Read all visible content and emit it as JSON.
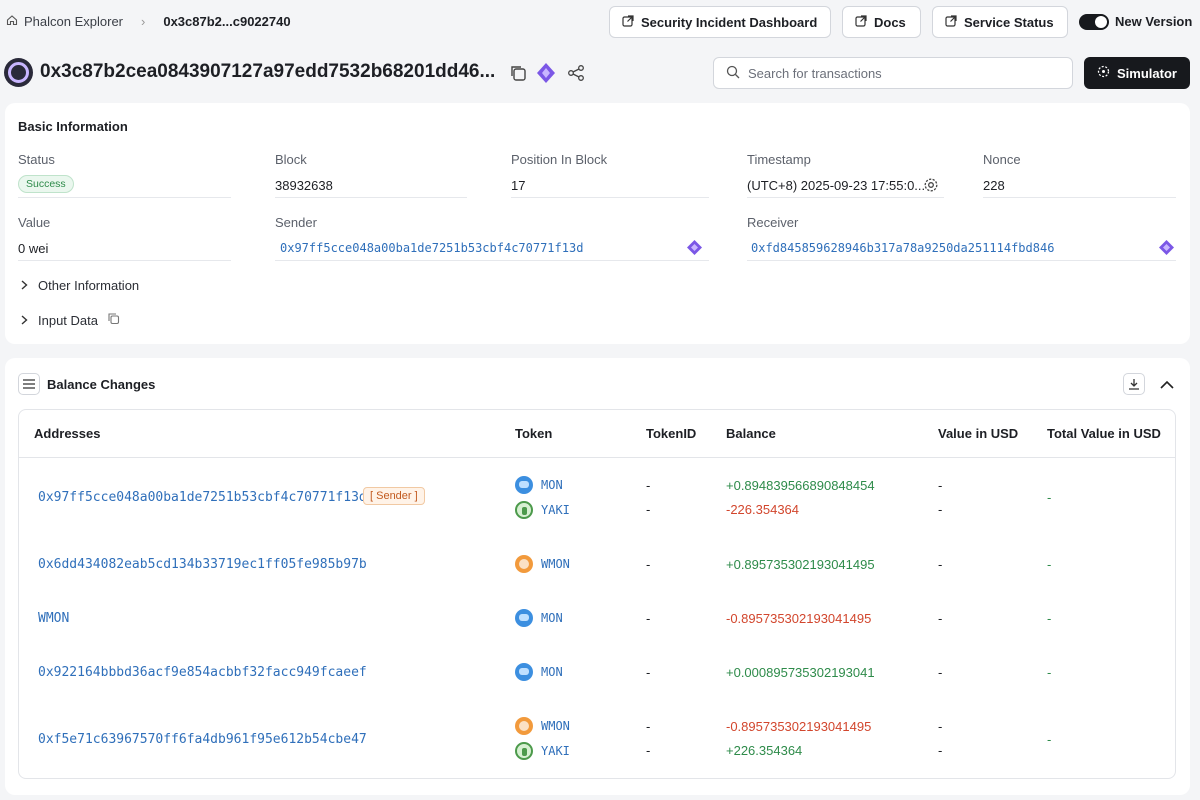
{
  "breadcrumb": {
    "home": "Phalcon Explorer",
    "current": "0x3c87b2...c9022740"
  },
  "header_buttons": {
    "incident": "Security Incident Dashboard",
    "docs": "Docs",
    "status": "Service Status",
    "new_version": "New Version"
  },
  "tx": {
    "hash": "0x3c87b2cea0843907127a97edd7532b68201dd46..."
  },
  "search": {
    "placeholder": "Search for transactions"
  },
  "simulator": {
    "label": "Simulator"
  },
  "basic": {
    "title": "Basic Information",
    "status_label": "Status",
    "status_value": "Success",
    "block_label": "Block",
    "block_value": "38932638",
    "position_label": "Position In Block",
    "position_value": "17",
    "timestamp_label": "Timestamp",
    "timestamp_value": "(UTC+8) 2025-09-23 17:55:0...",
    "nonce_label": "Nonce",
    "nonce_value": "228",
    "value_label": "Value",
    "value_value": "0 wei",
    "sender_label": "Sender",
    "sender_value": "0x97ff5cce048a00ba1de7251b53cbf4c70771f13d",
    "receiver_label": "Receiver",
    "receiver_value": "0xfd845859628946b317a78a9250da251114fbd846",
    "other_info": "Other Information",
    "input_data": "Input Data"
  },
  "balance": {
    "title": "Balance Changes",
    "headers": [
      "Addresses",
      "Token",
      "TokenID",
      "Balance",
      "Value in USD",
      "Total Value in USD"
    ],
    "sender_tag": "[ Sender ]",
    "rows": [
      {
        "address": "0x97ff5cce048a00ba1de7251b53cbf4c70771f13d",
        "tokens": [
          {
            "name": "MON",
            "tid": "-",
            "bal": "+0.894839566890848454",
            "usd": "-"
          },
          {
            "name": "YAKI",
            "tid": "-",
            "bal": "-226.354364",
            "usd": "-"
          }
        ],
        "total": "-"
      },
      {
        "address": "0x6dd434082eab5cd134b33719ec1ff05fe985b97b",
        "tokens": [
          {
            "name": "WMON",
            "tid": "-",
            "bal": "+0.895735302193041495",
            "usd": "-"
          }
        ],
        "total": "-"
      },
      {
        "address": "WMON",
        "tokens": [
          {
            "name": "MON",
            "tid": "-",
            "bal": "-0.895735302193041495",
            "usd": "-"
          }
        ],
        "total": "-"
      },
      {
        "address": "0x922164bbbd36acf9e854acbbf32facc949fcaeef",
        "tokens": [
          {
            "name": "MON",
            "tid": "-",
            "bal": "+0.000895735302193041",
            "usd": "-"
          }
        ],
        "total": "-"
      },
      {
        "address": "0xf5e71c63967570ff6fa4db961f95e612b54cbe47",
        "tokens": [
          {
            "name": "WMON",
            "tid": "-",
            "bal": "-0.895735302193041495",
            "usd": "-"
          },
          {
            "name": "YAKI",
            "tid": "-",
            "bal": "+226.354364",
            "usd": "-"
          }
        ],
        "total": "-"
      }
    ]
  },
  "colors": {
    "positive": "#2e8b4a",
    "negative": "#d2462d",
    "link": "#2f6fba",
    "dark_button": "#17191d"
  },
  "icons": [
    "home-icon",
    "chevron-right-icon",
    "external-link-icon",
    "copy-icon",
    "diamond-icon",
    "share-icon",
    "search-icon",
    "simulator-icon",
    "settings-icon",
    "list-icon",
    "download-icon",
    "chevron-up-icon"
  ]
}
